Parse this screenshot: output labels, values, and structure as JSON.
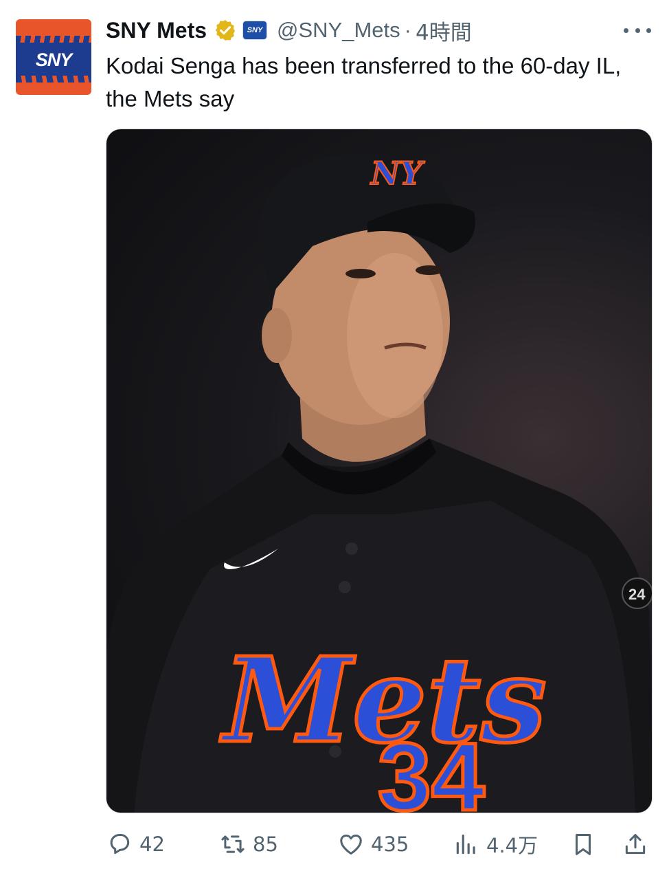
{
  "account": {
    "display_name": "SNY Mets",
    "handle": "@SNY_Mets",
    "separator": "·",
    "time": "4時間",
    "avatar_text": "SNY",
    "affiliate_badge_text": "SNY"
  },
  "tweet": {
    "text": "Kodai Senga has been transferred to the 60-day IL, the Mets say"
  },
  "media": {
    "jersey_script": "Mets",
    "jersey_number": "34",
    "sleeve_patch": "24"
  },
  "actions": {
    "replies": "42",
    "reposts": "85",
    "likes": "435",
    "views": "4.4万"
  },
  "colors": {
    "accent_blue": "#1d4ea8",
    "mets_orange": "#ff5910",
    "mets_blue": "#2c4fd8",
    "verified_gold": "#e2b719",
    "muted_text": "#536471"
  },
  "icons": [
    "more-icon",
    "verified-gold-icon",
    "reply-icon",
    "repost-icon",
    "like-icon",
    "views-icon",
    "bookmark-icon",
    "share-icon"
  ]
}
